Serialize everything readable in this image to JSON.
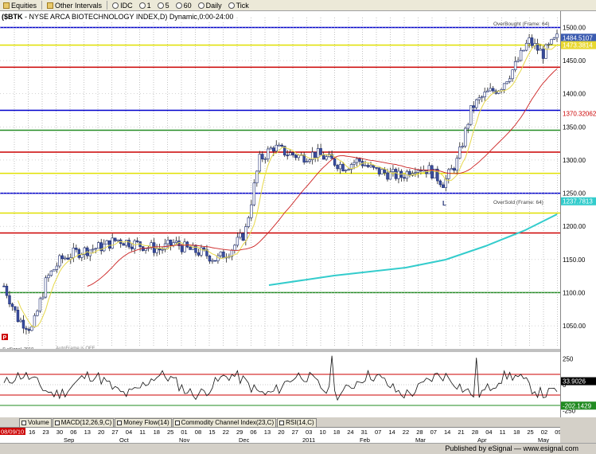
{
  "toolbar": {
    "equities_label": "Equities",
    "other_intervals_label": "Other Intervals",
    "idc_label": "IDC",
    "one_label": "1",
    "five_label": "5",
    "sixty_label": "60",
    "daily_label": "Daily",
    "tick_label": "Tick"
  },
  "chart": {
    "symbol": "($BTK",
    "title_rest": " - NYSE ARCA BIOTECHNOLOGY INDEX,D) Dynamic,0:00-24:00",
    "overbought_label": "OverBought (Frame: 64)",
    "oversold_label": "OverSold (Frame: 64)",
    "esignal_mark": "© eSignal, 2010",
    "autoframe_label": "AutoFrame is OFF",
    "low_marker": "L",
    "p_marker": "P"
  },
  "price_axis": {
    "ticks": [
      "1500.00",
      "1450.00",
      "1400.00",
      "1350.00",
      "1300.00",
      "1250.00",
      "1200.00",
      "1150.00",
      "1100.00",
      "1050.00"
    ],
    "last_price": "1484.5107",
    "yellow_level": "1473.3814",
    "red_level": "1370.32062",
    "blue_level": "1237.7813"
  },
  "indicator_axis": {
    "ticks": [
      "250",
      "0",
      "-250"
    ],
    "cci_value": "33.9026",
    "cci_neg_value": "-202.1429"
  },
  "indicator_tabs": [
    "Volume",
    "MACD(12,26,9,C)",
    "Money Flow(14)",
    "Commodity Channel Index(23,C)",
    "RSI(14,C)"
  ],
  "dates": {
    "first_label": "08/09/10",
    "days": [
      "16",
      "23",
      "30",
      "06",
      "13",
      "20",
      "27",
      "04",
      "11",
      "18",
      "25",
      "01",
      "08",
      "15",
      "22",
      "29",
      "06",
      "13",
      "20",
      "27",
      "03",
      "10",
      "18",
      "24",
      "31",
      "07",
      "14",
      "22",
      "28",
      "07",
      "14",
      "21",
      "28",
      "04",
      "11",
      "18",
      "25",
      "02",
      "09"
    ],
    "months": [
      "Sep",
      "Oct",
      "Nov",
      "Dec",
      "2011",
      "Feb",
      "Mar",
      "Apr",
      "May"
    ]
  },
  "status": {
    "published": "Published by eSignal — www.esignal.com"
  },
  "chart_data": {
    "type": "candlestick",
    "title": "($BTK - NYSE ARCA BIOTECHNOLOGY INDEX,D) Dynamic,0:00-24:00",
    "ylim": [
      1020,
      1515
    ],
    "x": [
      "2010-08-09",
      "2010-08-16",
      "2010-08-23",
      "2010-08-30",
      "2010-09-06",
      "2010-09-13",
      "2010-09-20",
      "2010-09-27",
      "2010-10-04",
      "2010-10-11",
      "2010-10-18",
      "2010-10-25",
      "2010-11-01",
      "2010-11-08",
      "2010-11-15",
      "2010-11-22",
      "2010-11-29",
      "2010-12-06",
      "2010-12-13",
      "2010-12-20",
      "2010-12-27",
      "2011-01-03",
      "2011-01-10",
      "2011-01-18",
      "2011-01-24",
      "2011-01-31",
      "2011-02-07",
      "2011-02-14",
      "2011-02-22",
      "2011-02-28",
      "2011-03-07",
      "2011-03-14",
      "2011-03-21",
      "2011-03-28",
      "2011-04-04",
      "2011-04-11",
      "2011-04-18",
      "2011-04-25",
      "2011-05-02",
      "2011-05-09"
    ],
    "close": [
      1110,
      1060,
      1045,
      1120,
      1150,
      1160,
      1165,
      1170,
      1180,
      1175,
      1170,
      1165,
      1175,
      1165,
      1160,
      1150,
      1165,
      1190,
      1300,
      1320,
      1310,
      1305,
      1310,
      1300,
      1290,
      1300,
      1285,
      1280,
      1275,
      1290,
      1285,
      1265,
      1300,
      1380,
      1400,
      1410,
      1440,
      1480,
      1460,
      1484
    ],
    "horizontal_levels": [
      {
        "value": 1500,
        "color": "#0000cc"
      },
      {
        "value": 1473.38,
        "color": "#e0e000"
      },
      {
        "value": 1440,
        "color": "#cc0000"
      },
      {
        "value": 1375,
        "color": "#0000cc"
      },
      {
        "value": 1345,
        "color": "#228b22"
      },
      {
        "value": 1312,
        "color": "#cc0000"
      },
      {
        "value": 1280,
        "color": "#e0e000"
      },
      {
        "value": 1250,
        "color": "#0000cc"
      },
      {
        "value": 1220,
        "color": "#e0e000"
      },
      {
        "value": 1190,
        "color": "#cc0000"
      },
      {
        "value": 1100,
        "color": "#228b22"
      }
    ],
    "indicator": {
      "name": "Commodity Channel Index(23,C)",
      "ylim": [
        -300,
        300
      ],
      "last": 33.9026
    }
  }
}
